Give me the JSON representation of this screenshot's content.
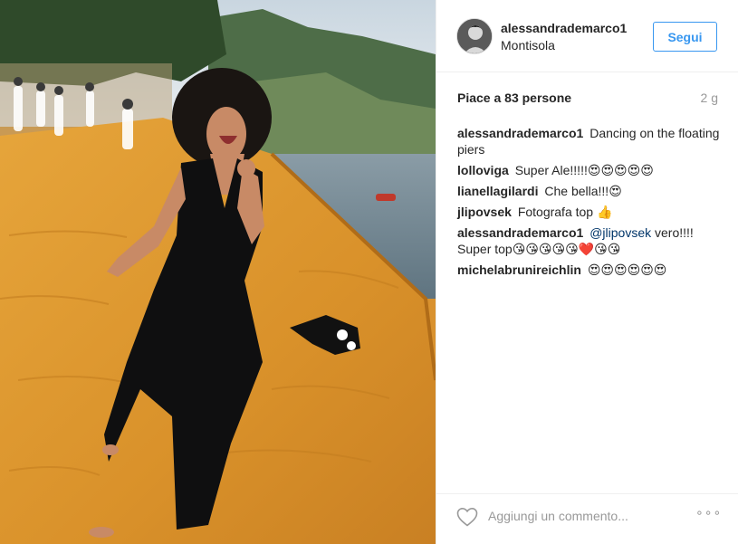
{
  "post": {
    "username": "alessandrademarco1",
    "location": "Montisola",
    "follow_label": "Segui",
    "likes": "Piace a 83 persone",
    "time": "2 g"
  },
  "comments": [
    {
      "user": "alessandrademarco1",
      "text": "Dancing on the floating piers"
    },
    {
      "user": "lolloviga",
      "text": "Super Ale!!!!!😍😍😍😍😍"
    },
    {
      "user": "lianellagilardi",
      "text": "Che bella!!!😍"
    },
    {
      "user": "jlipovsek",
      "text": "Fotografa top 👍"
    },
    {
      "user": "alessandrademarco1",
      "mention": "@jlipovsek",
      "text": " vero!!!! Super top😘😘😘😘😘❤️😘😘"
    },
    {
      "user": "michelabrunireichlin",
      "text": "😍😍😍😍😍😍"
    }
  ],
  "footer": {
    "comment_placeholder": "Aggiungi un commento...",
    "more_label": "∘∘∘"
  },
  "icons": {
    "like": "heart-outline-icon",
    "more": "ellipsis-icon"
  },
  "colors": {
    "accent": "#3897f0",
    "text": "#262626",
    "muted": "#999999",
    "border": "#efefef"
  }
}
